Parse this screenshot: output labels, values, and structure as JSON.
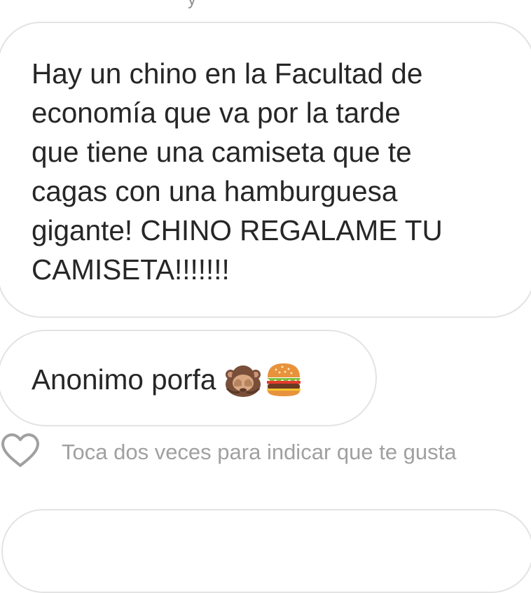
{
  "messages": [
    {
      "text": "Hay un chino en la Facultad de\neconomía que va por la tarde\nque tiene una camiseta que te\ncagas con una hamburguesa\ngigante! CHINO REGALAME TU\nCAMISETA!!!!!!!"
    },
    {
      "text": "Anonimo porfa",
      "emojis": [
        "see-no-evil-monkey",
        "hamburger"
      ]
    }
  ],
  "like": {
    "icon": "heart-outline-icon",
    "hint": "Toca dos veces para indicar que te gusta"
  },
  "top_fragment": "y"
}
